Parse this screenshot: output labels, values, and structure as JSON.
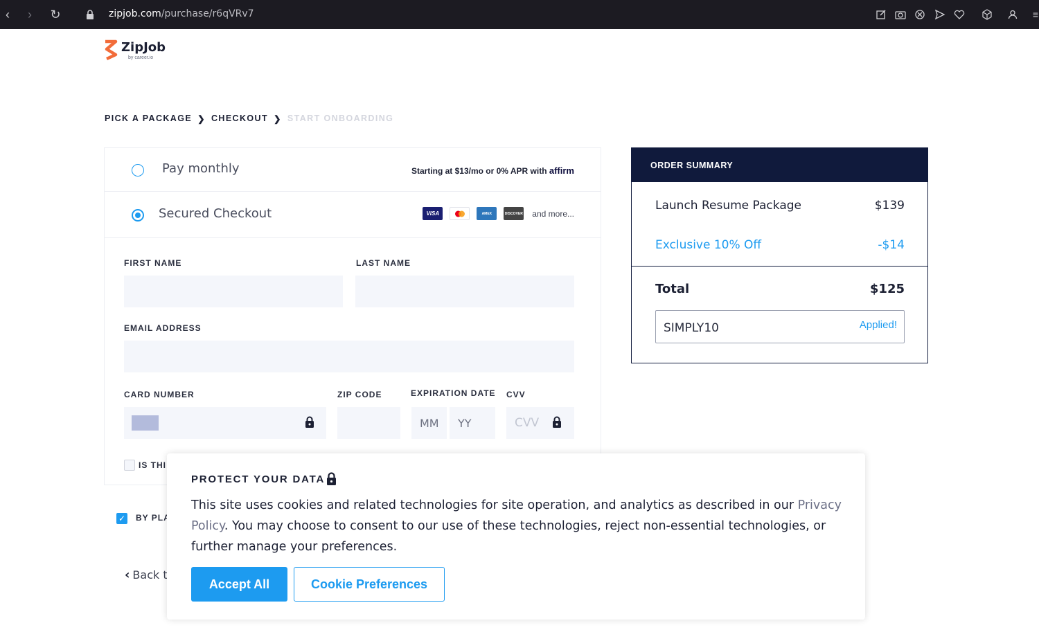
{
  "browser": {
    "url_host": "zipjob.com",
    "url_path": "/purchase/r6qVRv7"
  },
  "logo": {
    "name": "ZipJob",
    "sub": "by career.io"
  },
  "breadcrumb": {
    "step1": "PICK A PACKAGE",
    "step2": "CHECKOUT",
    "step3": "START ONBOARDING",
    "sep": "❯"
  },
  "payment": {
    "monthly_label": "Pay monthly",
    "affirm_text": "Starting at $13/mo or 0% APR with",
    "affirm_brand": "affirm",
    "secured_label": "Secured Checkout",
    "cards": [
      "VISA",
      "MC",
      "AMEX",
      "DISCOVER"
    ],
    "more_label": "and more..."
  },
  "form": {
    "first_name_label": "FIRST NAME",
    "last_name_label": "LAST NAME",
    "email_label": "EMAIL ADDRESS",
    "card_label": "CARD NUMBER",
    "zip_label": "ZIP CODE",
    "exp_label": "EXPIRATION DATE",
    "cvv_label": "CVV",
    "mm_placeholder": "MM",
    "yy_placeholder": "YY",
    "cvv_placeholder": "CVV",
    "gift_checkbox_label": "IS THI",
    "terms_label": "BY PLA",
    "back_label": "Back t"
  },
  "summary": {
    "title": "ORDER SUMMARY",
    "package_name": "Launch Resume Package",
    "package_price": "$139",
    "discount_name": "Exclusive 10% Off",
    "discount_value": "-$14",
    "total_label": "Total",
    "total_value": "$125",
    "coupon_code": "SIMPLY10",
    "coupon_status": "Applied!"
  },
  "cookie": {
    "title": "PROTECT YOUR DATA",
    "body_before": "This site uses cookies and related technologies for site operation, and analytics as described in our ",
    "privacy_link": "Privacy Policy",
    "body_after": ". You may choose to consent to our use of these technologies, reject non-essential technologies, or further manage your preferences.",
    "accept_label": "Accept All",
    "prefs_label": "Cookie Preferences"
  },
  "colors": {
    "accent": "#1d9bf0",
    "navy": "#101a3c",
    "logo_orange": "#f26c3a"
  }
}
